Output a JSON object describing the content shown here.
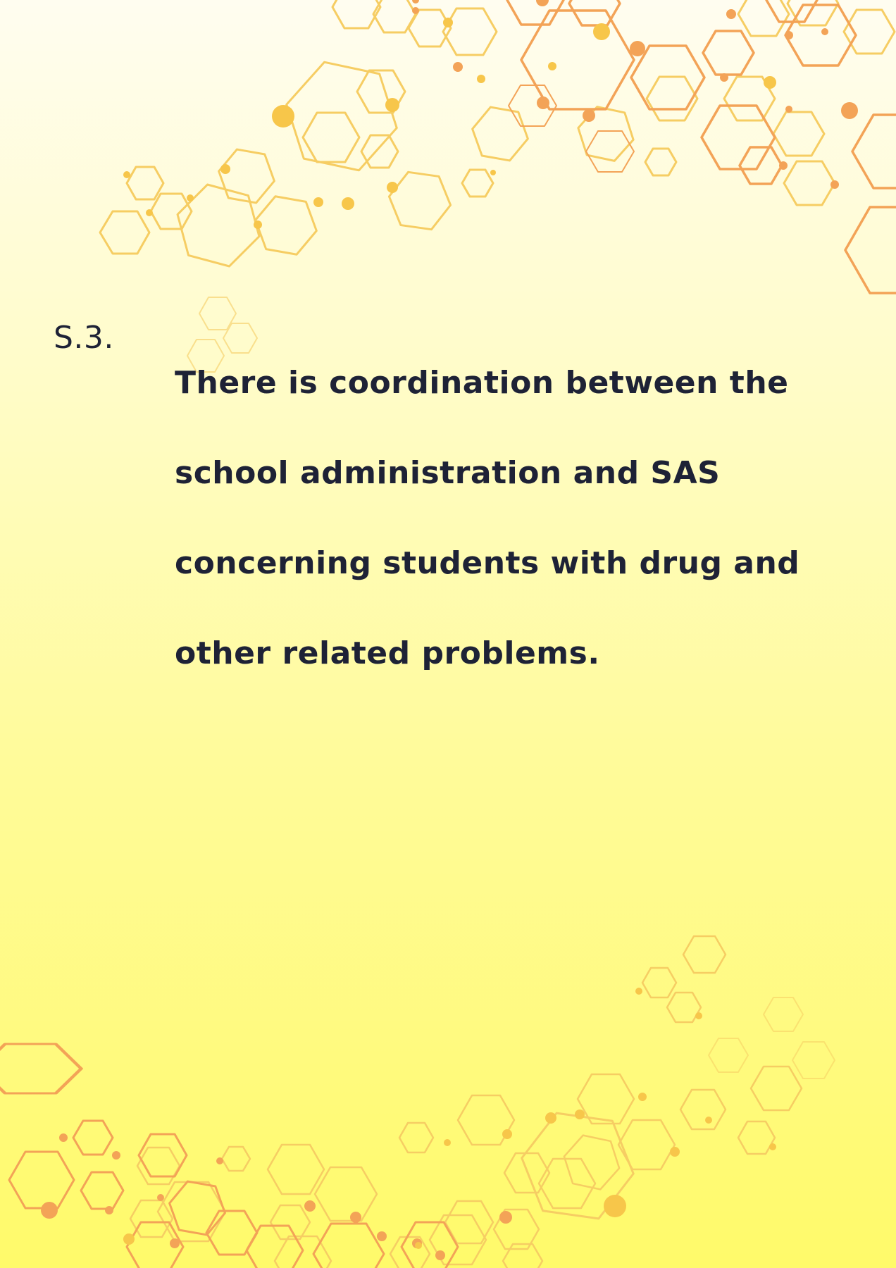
{
  "statement": {
    "number": "S.3.",
    "text_lines": [
      "There is coordination between the",
      "school administration and SAS",
      "concerning students with drug and",
      "other related problems."
    ]
  },
  "colors": {
    "text": "#1e2236",
    "hex_yellow": "#f7c64a",
    "hex_orange": "#f1a04e"
  }
}
